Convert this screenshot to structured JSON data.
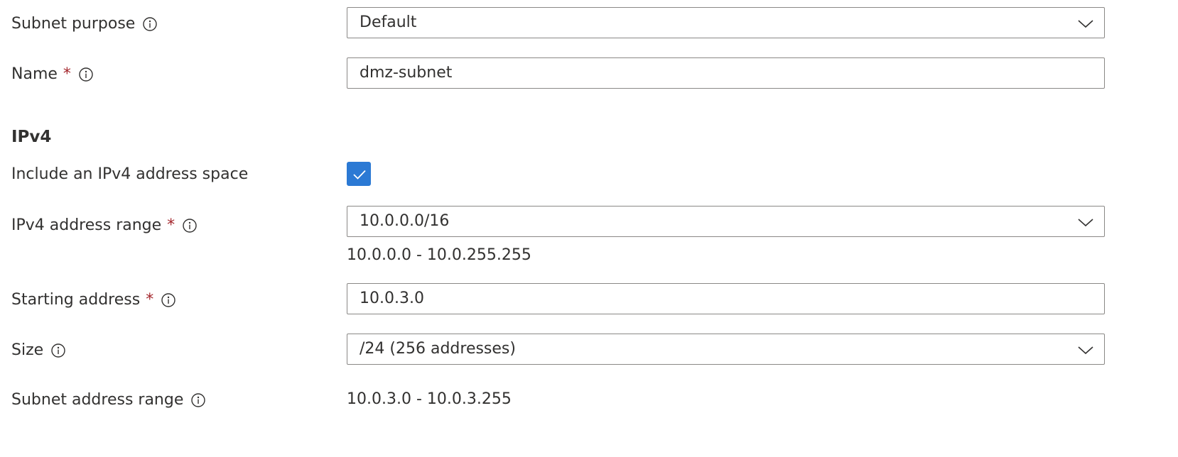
{
  "form": {
    "subnet_purpose": {
      "label": "Subnet purpose",
      "value": "Default",
      "info_icon": "info-icon"
    },
    "name": {
      "label": "Name",
      "required_mark": "*",
      "value": "dmz-subnet",
      "info_icon": "info-icon"
    },
    "ipv4_section": {
      "heading": "IPv4"
    },
    "include_ipv4": {
      "label": "Include an IPv4 address space",
      "checked": true,
      "icon": "checkmark-icon"
    },
    "ipv4_address_range": {
      "label": "IPv4 address range",
      "required_mark": "*",
      "value": "10.0.0.0/16",
      "range_text": "10.0.0.0 - 10.0.255.255",
      "info_icon": "info-icon"
    },
    "starting_address": {
      "label": "Starting address",
      "required_mark": "*",
      "value": "10.0.3.0",
      "info_icon": "info-icon"
    },
    "size": {
      "label": "Size",
      "value": "/24 (256 addresses)",
      "info_icon": "info-icon"
    },
    "subnet_address_range": {
      "label": "Subnet address range",
      "value": "10.0.3.0 - 10.0.3.255",
      "info_icon": "info-icon"
    }
  },
  "colors": {
    "text": "#323130",
    "required": "#a4262c",
    "border": "#8a8886",
    "accent": "#2b79d4"
  }
}
